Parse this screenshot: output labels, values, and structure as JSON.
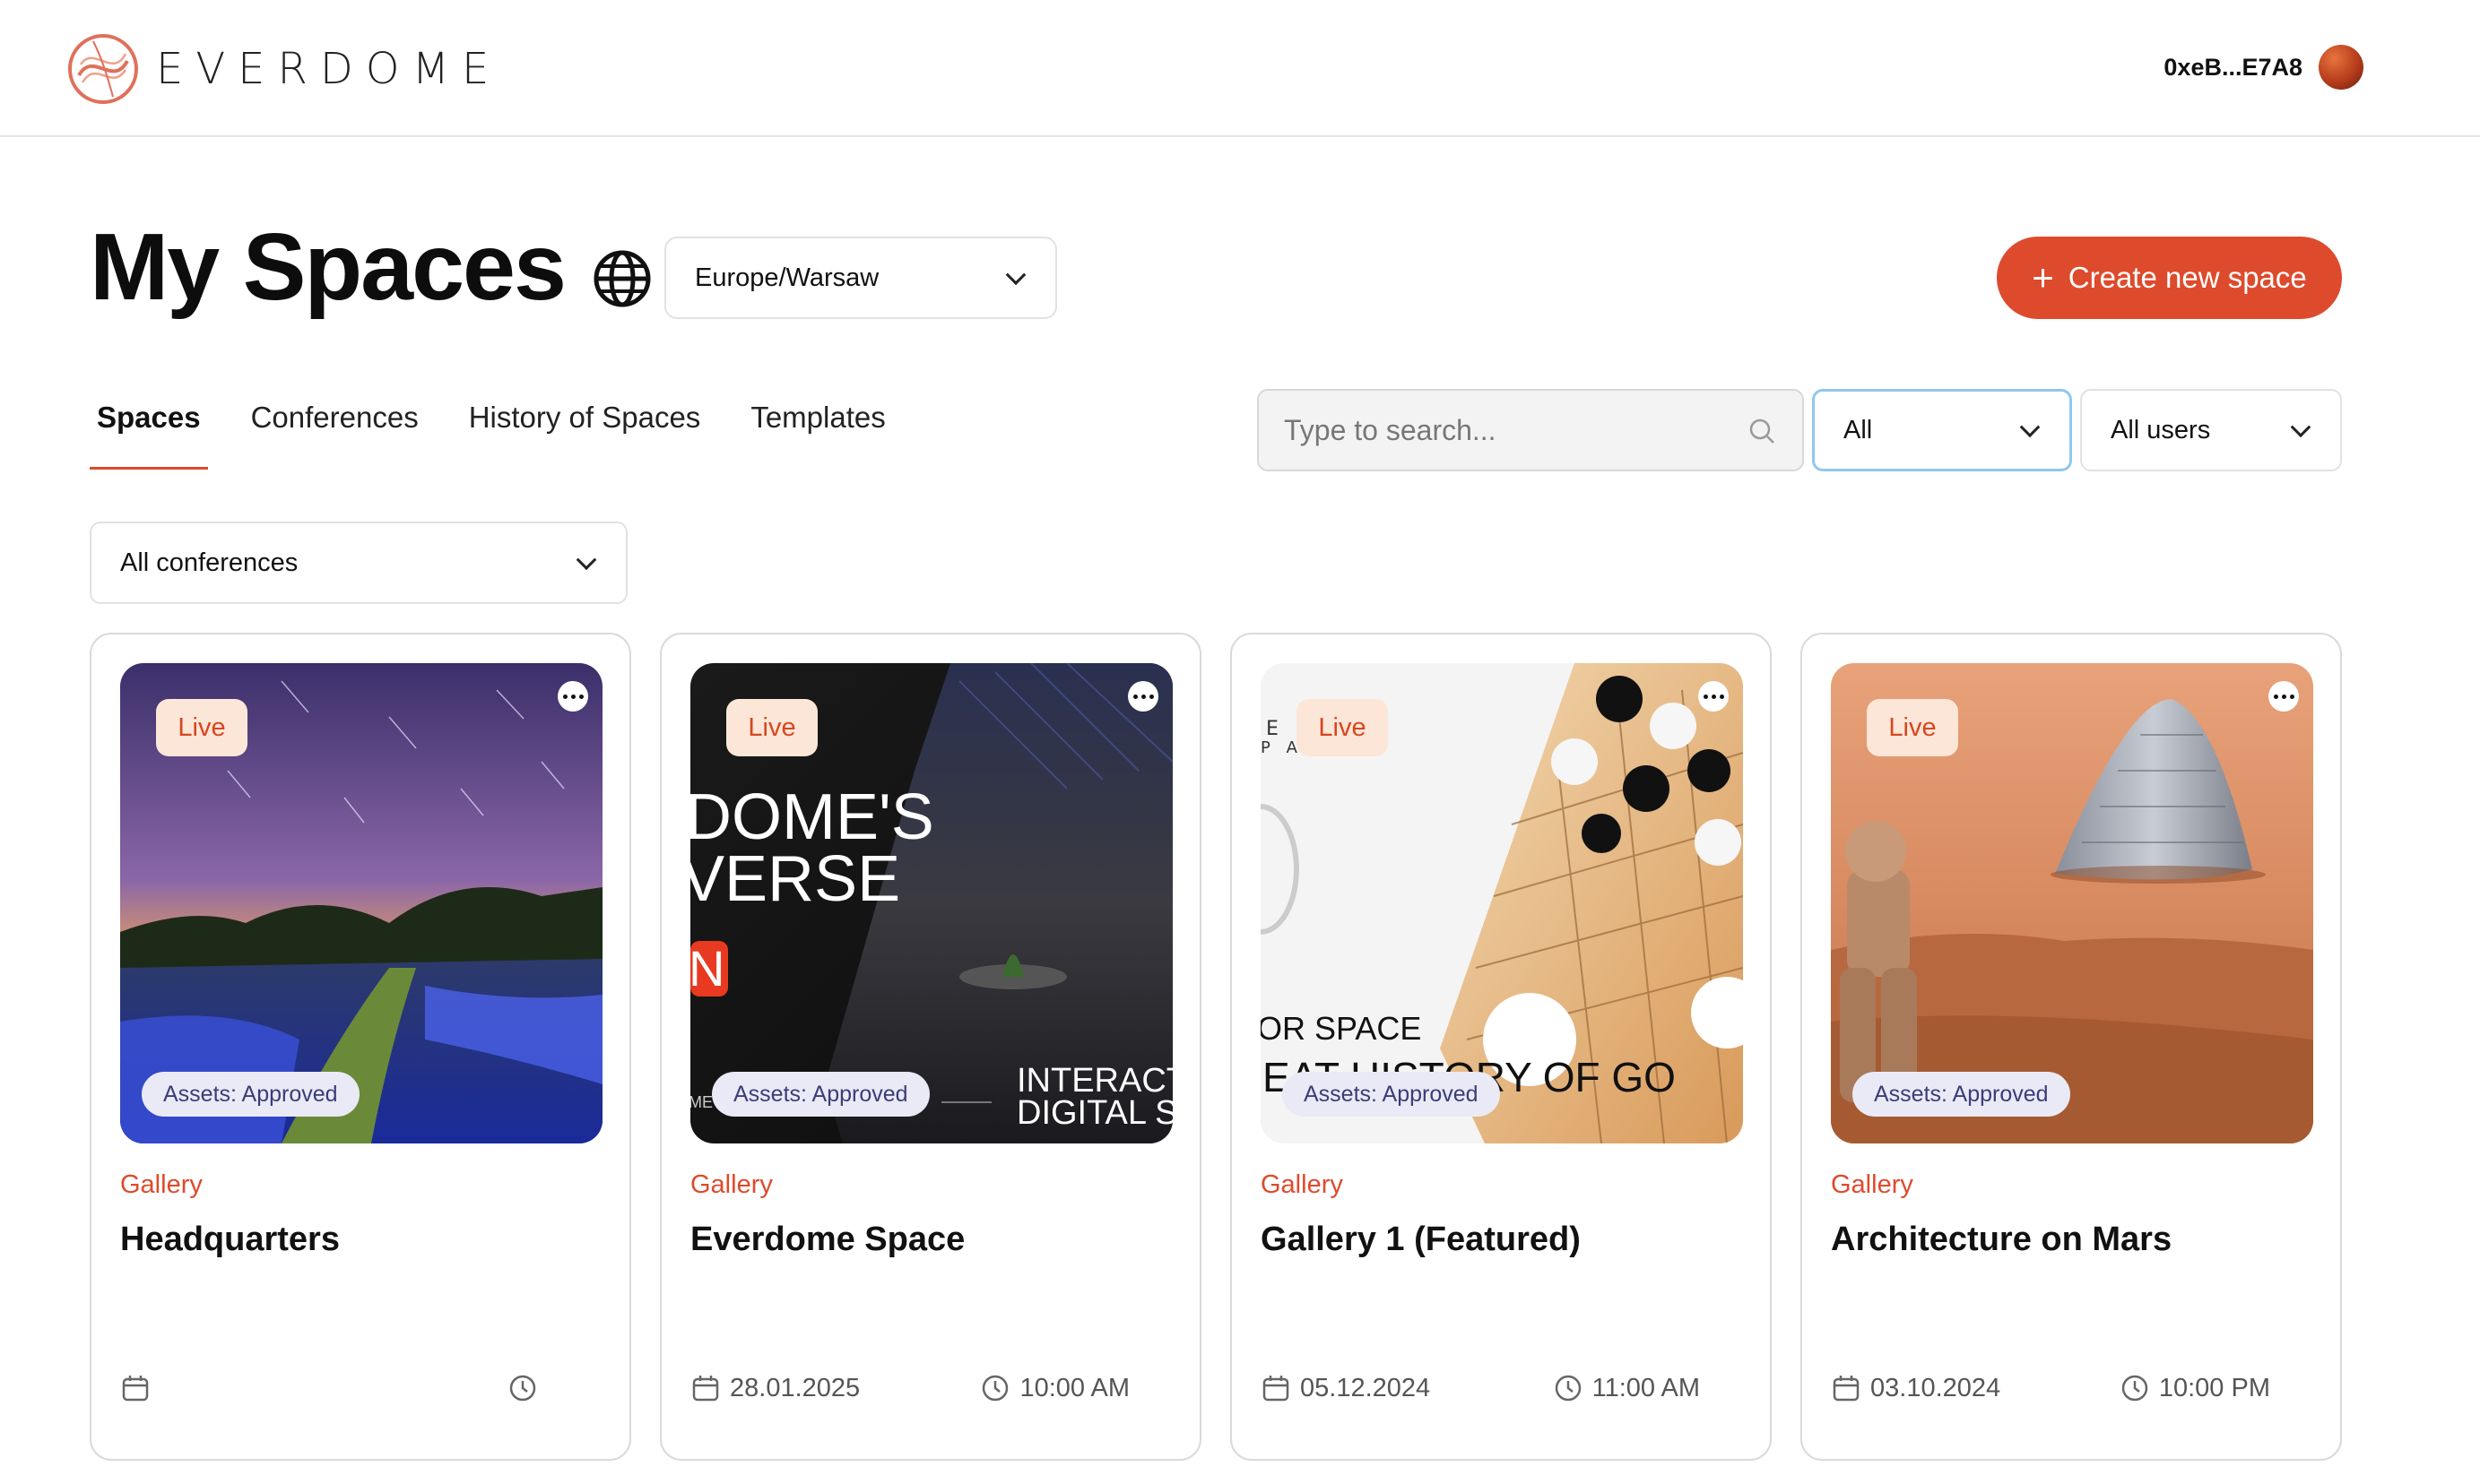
{
  "header": {
    "brand": "EVERDOME",
    "wallet": "0xeB...E7A8"
  },
  "page": {
    "title": "My Spaces",
    "timezone": "Europe/Warsaw",
    "create_button": "Create new space"
  },
  "tabs": [
    {
      "label": "Spaces",
      "active": true
    },
    {
      "label": "Conferences",
      "active": false
    },
    {
      "label": "History of Spaces",
      "active": false
    },
    {
      "label": "Templates",
      "active": false
    }
  ],
  "filters": {
    "search_placeholder": "Type to search...",
    "status": "All",
    "users": "All users",
    "conference": "All conferences"
  },
  "colors": {
    "accent": "#de4a2c",
    "live_badge_bg": "#fce6d8",
    "assets_badge_bg": "#eaeaf6",
    "focus_border": "#8ec8ee"
  },
  "cards": [
    {
      "status": "Live",
      "assets": "Assets: Approved",
      "category": "Gallery",
      "title": "Headquarters",
      "date": "",
      "time": "",
      "thumb_text": []
    },
    {
      "status": "Live",
      "assets": "Assets: Approved",
      "category": "Gallery",
      "title": "Everdome Space",
      "date": "28.01.2025",
      "time": "10:00 AM",
      "thumb_text": [
        "DOME'S",
        "VERSE",
        "N",
        "INTERACT",
        "DIGITAL SI",
        "ME"
      ]
    },
    {
      "status": "Live",
      "assets": "Assets: Approved",
      "category": "Gallery",
      "title": "Gallery 1 (Featured)",
      "date": "05.12.2024",
      "time": "11:00 AM",
      "thumb_text": [
        "E  E",
        "P  A  C  E  S",
        "OR SPACE",
        "EAT HISTORY OF GO"
      ]
    },
    {
      "status": "Live",
      "assets": "Assets: Approved",
      "category": "Gallery",
      "title": "Architecture on Mars",
      "date": "03.10.2024",
      "time": "10:00 PM",
      "thumb_text": []
    }
  ]
}
